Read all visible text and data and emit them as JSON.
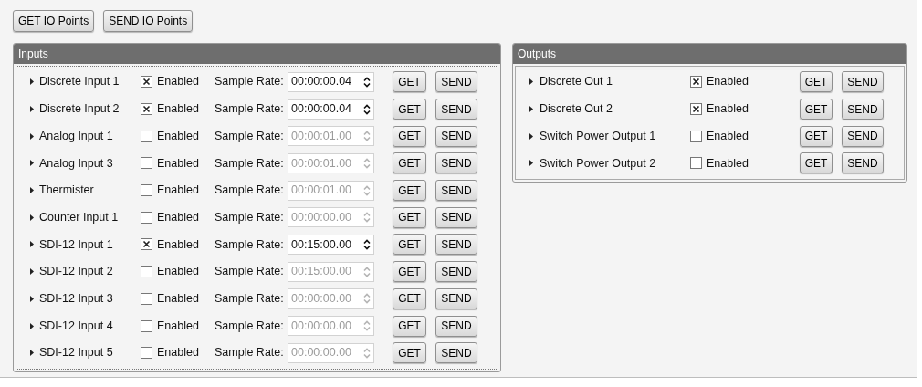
{
  "toolbar": [
    {
      "label": "GET IO Points"
    },
    {
      "label": "SEND IO Points"
    }
  ],
  "inputs": {
    "title": "Inputs",
    "rows": [
      {
        "name": "Discrete Input 1",
        "checked": true,
        "enabled_label": "Enabled",
        "rate_label": "Sample Rate:",
        "rate": "00:00:00.04",
        "get": "GET",
        "send": "SEND"
      },
      {
        "name": "Discrete Input 2",
        "checked": true,
        "enabled_label": "Enabled",
        "rate_label": "Sample Rate:",
        "rate": "00:00:00.04",
        "get": "GET",
        "send": "SEND"
      },
      {
        "name": "Analog Input 1",
        "checked": false,
        "enabled_label": "Enabled",
        "rate_label": "Sample Rate:",
        "rate": "00:00:01.00",
        "get": "GET",
        "send": "SEND"
      },
      {
        "name": "Analog Input 3",
        "checked": false,
        "enabled_label": "Enabled",
        "rate_label": "Sample Rate:",
        "rate": "00:00:01.00",
        "get": "GET",
        "send": "SEND"
      },
      {
        "name": "Thermister",
        "checked": false,
        "enabled_label": "Enabled",
        "rate_label": "Sample Rate:",
        "rate": "00:00:01.00",
        "get": "GET",
        "send": "SEND"
      },
      {
        "name": "Counter Input 1",
        "checked": false,
        "enabled_label": "Enabled",
        "rate_label": "Sample Rate:",
        "rate": "00:00:00.00",
        "get": "GET",
        "send": "SEND"
      },
      {
        "name": "SDI-12 Input 1",
        "checked": true,
        "enabled_label": "Enabled",
        "rate_label": "Sample Rate:",
        "rate": "00:15:00.00",
        "get": "GET",
        "send": "SEND"
      },
      {
        "name": "SDI-12 Input 2",
        "checked": false,
        "enabled_label": "Enabled",
        "rate_label": "Sample Rate:",
        "rate": "00:15:00.00",
        "get": "GET",
        "send": "SEND"
      },
      {
        "name": "SDI-12 Input 3",
        "checked": false,
        "enabled_label": "Enabled",
        "rate_label": "Sample Rate:",
        "rate": "00:00:00.00",
        "get": "GET",
        "send": "SEND"
      },
      {
        "name": "SDI-12 Input 4",
        "checked": false,
        "enabled_label": "Enabled",
        "rate_label": "Sample Rate:",
        "rate": "00:00:00.00",
        "get": "GET",
        "send": "SEND"
      },
      {
        "name": "SDI-12 Input 5",
        "checked": false,
        "enabled_label": "Enabled",
        "rate_label": "Sample Rate:",
        "rate": "00:00:00.00",
        "get": "GET",
        "send": "SEND"
      }
    ]
  },
  "outputs": {
    "title": "Outputs",
    "rows": [
      {
        "name": "Discrete Out 1",
        "checked": true,
        "enabled_label": "Enabled",
        "get": "GET",
        "send": "SEND"
      },
      {
        "name": "Discrete Out 2",
        "checked": true,
        "enabled_label": "Enabled",
        "get": "GET",
        "send": "SEND"
      },
      {
        "name": "Switch Power Output 1",
        "checked": false,
        "enabled_label": "Enabled",
        "get": "GET",
        "send": "SEND"
      },
      {
        "name": "Switch Power Output 2",
        "checked": false,
        "enabled_label": "Enabled",
        "get": "GET",
        "send": "SEND"
      }
    ]
  }
}
